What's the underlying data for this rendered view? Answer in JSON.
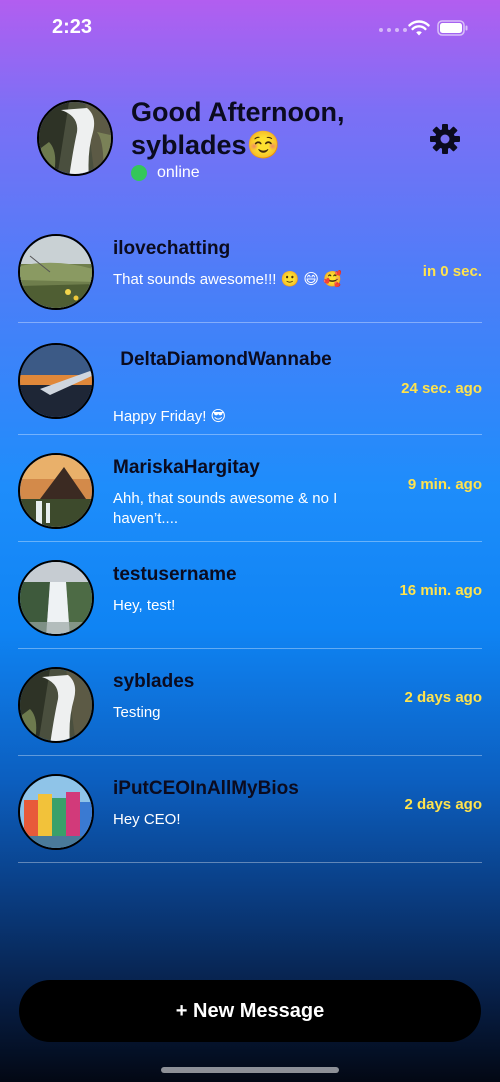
{
  "status_bar": {
    "time": "2:23"
  },
  "header": {
    "greeting": "Good Afternoon, syblades☺️",
    "status": "online",
    "avatar": "waterfall-photo"
  },
  "chats": [
    {
      "name": "ilovechatting",
      "preview": "That sounds awesome!!! 🙂 😄 🥰",
      "time": "in 0 sec.",
      "avatar": "meadow-photo"
    },
    {
      "name": "DeltaDiamondWannabe",
      "preview": "Happy Friday! 😎",
      "time": "24 sec. ago",
      "avatar": "airplane-wing-photo"
    },
    {
      "name": "MariskaHargitay",
      "preview": "Ahh, that sounds awesome & no I haven’t....",
      "time": "9 min. ago",
      "avatar": "mountain-photo"
    },
    {
      "name": "testusername",
      "preview": "Hey, test!",
      "time": "16 min. ago",
      "avatar": "falls-photo"
    },
    {
      "name": "syblades",
      "preview": "Testing",
      "time": "2 days ago",
      "avatar": "waterfall-photo"
    },
    {
      "name": "iPutCEOInAllMyBios",
      "preview": "Hey CEO!",
      "time": "2 days ago",
      "avatar": "colorful-houses-photo"
    }
  ],
  "new_message": {
    "label": "+ New Message"
  },
  "colors": {
    "time_yellow": "#ffe34d",
    "online_green": "#34c759"
  }
}
